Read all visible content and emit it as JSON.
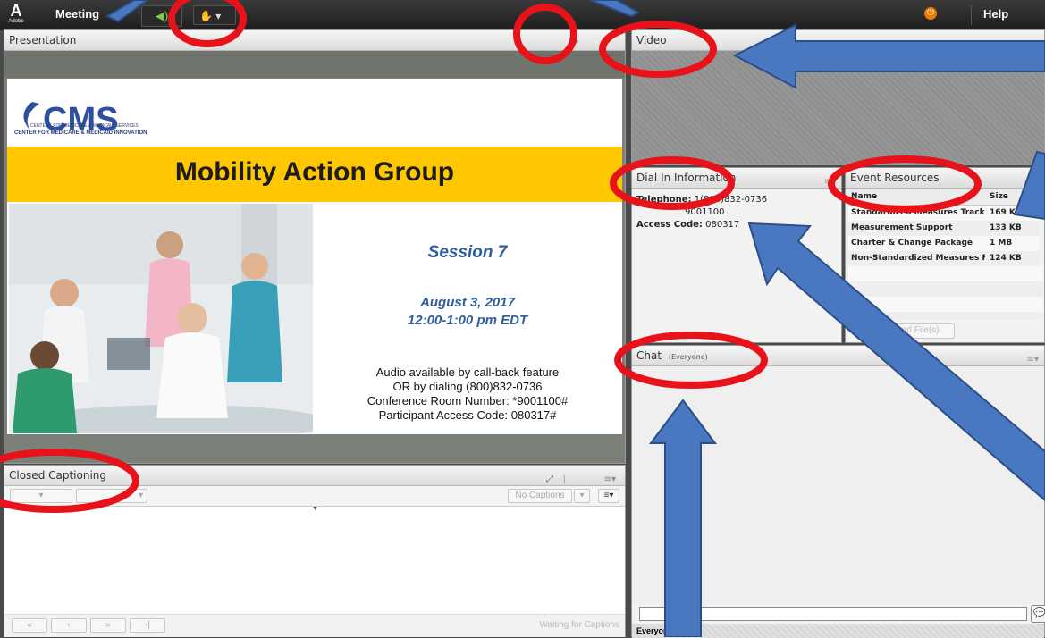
{
  "menubar": {
    "logo_text": "A",
    "logo_sub": "Adobe",
    "meeting_label": "Meeting",
    "help_label": "Help",
    "audio_icon": "speaker-icon",
    "status_icon": "raise-hand-icon",
    "power_icon": "power-icon"
  },
  "presentation": {
    "title": "Presentation",
    "slide": {
      "logo_text": "CMS",
      "logo_line1": "CENTERS FOR MEDICARE & MEDICAID SERVICES",
      "logo_line2": "CENTER FOR MEDICARE & MEDICAID INNOVATION",
      "title": "Mobility Action Group",
      "session": "Session 7",
      "date": "August 3, 2017",
      "time": "12:00-1:00 pm EDT",
      "audio_line1": "Audio available by call-back feature",
      "audio_line2": "OR by dialing (800)832-0736",
      "audio_line3": "Conference Room Number: *9001100#",
      "audio_line4": "Participant Access Code: 080317#"
    }
  },
  "closed_captioning": {
    "title": "Closed Captioning",
    "no_captions_label": "No Captions",
    "status": "Waiting for Captions"
  },
  "video": {
    "title": "Video"
  },
  "dial_in": {
    "title": "Dial In Information",
    "telephone_label": "Telephone:",
    "telephone_value": "1(800)832-0736",
    "room_value": "9001100",
    "access_label": "Access Code:",
    "access_value": "080317"
  },
  "event_resources": {
    "title": "Event Resources",
    "columns": [
      "Name",
      "Size"
    ],
    "rows": [
      {
        "name": "Standardized Measures Tracking",
        "size": "169 KB"
      },
      {
        "name": "Measurement Support",
        "size": "133 KB"
      },
      {
        "name": "Charter & Change Package",
        "size": "1 MB"
      },
      {
        "name": "Non-Standardized Measures For",
        "size": "124 KB"
      }
    ],
    "download_label": "Download File(s)"
  },
  "chat": {
    "title": "Chat",
    "audience": "(Everyone)",
    "footer_label": "Everyone"
  },
  "colors": {
    "slide_band": "#ffc700",
    "session_blue": "#2f5da0",
    "annotation_red": "#e8121a",
    "annotation_arrow": "#4a78c0"
  }
}
